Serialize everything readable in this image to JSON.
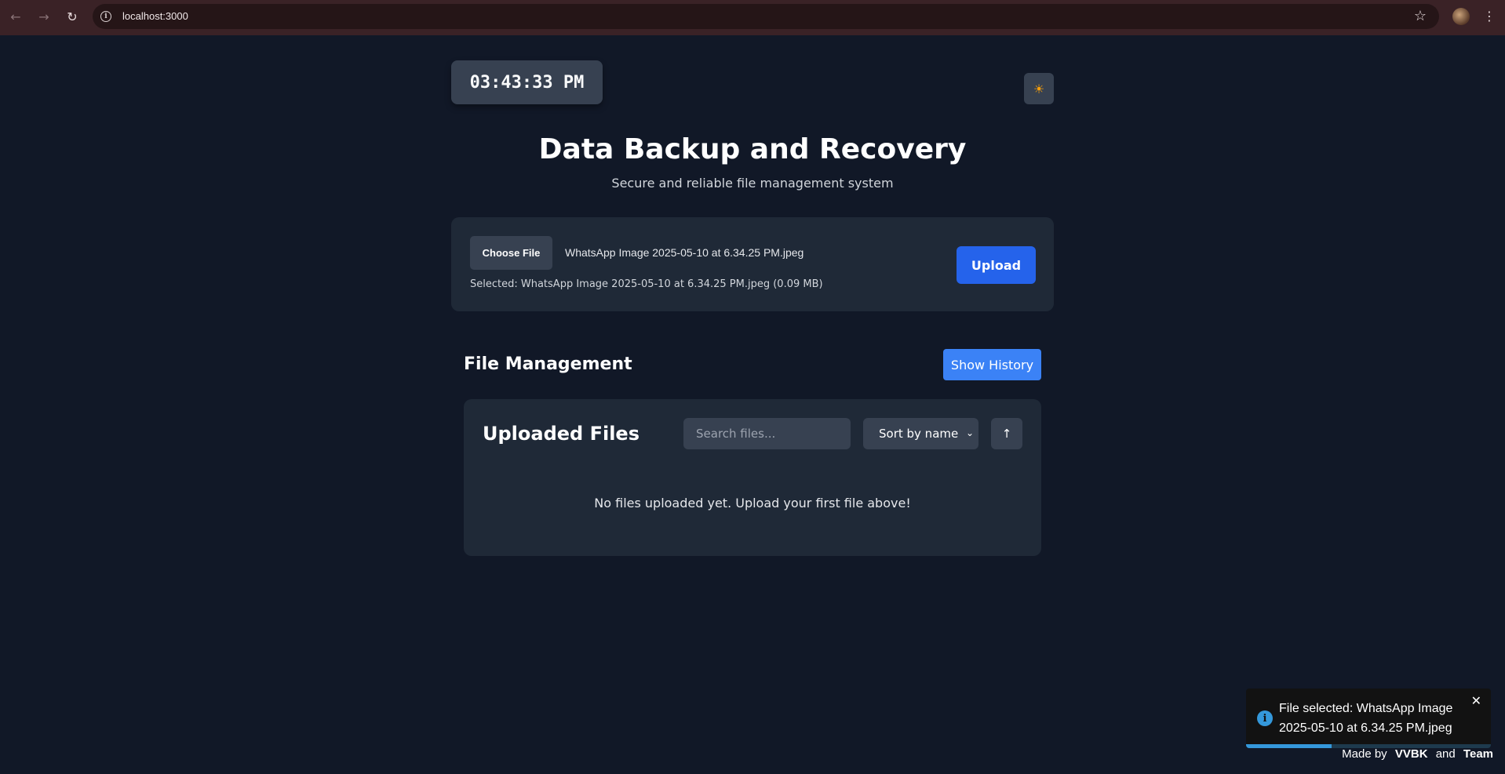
{
  "browser": {
    "url": "localhost:3000",
    "back_icon": "arrow-left-icon",
    "forward_icon": "arrow-right-icon",
    "reload_icon": "reload-icon",
    "bookmark_icon": "star-icon",
    "menu_icon": "kebab-menu-icon"
  },
  "header": {
    "clock": "03:43:33 PM",
    "theme_icon": "sun-icon",
    "title": "Data Backup and Recovery",
    "subtitle": "Secure and reliable file management system"
  },
  "upload": {
    "choose_label": "Choose File",
    "chosen_filename": "WhatsApp Image 2025-05-10 at 6.34.25 PM.jpeg",
    "selected_info": "Selected: WhatsApp Image 2025-05-10 at 6.34.25 PM.jpeg (0.09 MB)",
    "upload_label": "Upload"
  },
  "file_management": {
    "title": "File Management",
    "history_label": "Show History",
    "files_title": "Uploaded Files",
    "search_placeholder": "Search files...",
    "sort_value": "Sort by name",
    "sort_direction_glyph": "↑",
    "empty_message": "No files uploaded yet. Upload your first file above!"
  },
  "toast": {
    "icon": "info-icon",
    "message": "File selected: WhatsApp Image 2025-05-10 at 6.34.25 PM.jpeg",
    "close_glyph": "✕",
    "progress_remaining": 0.35,
    "accent_color": "#3498db"
  },
  "footer": {
    "prefix": "Made by",
    "author": "VVBK",
    "joiner": "and",
    "team": "Team"
  },
  "colors": {
    "background": "#111827",
    "card": "#1f2937",
    "primary": "#2563eb",
    "secondary_button": "#3b82f6"
  }
}
